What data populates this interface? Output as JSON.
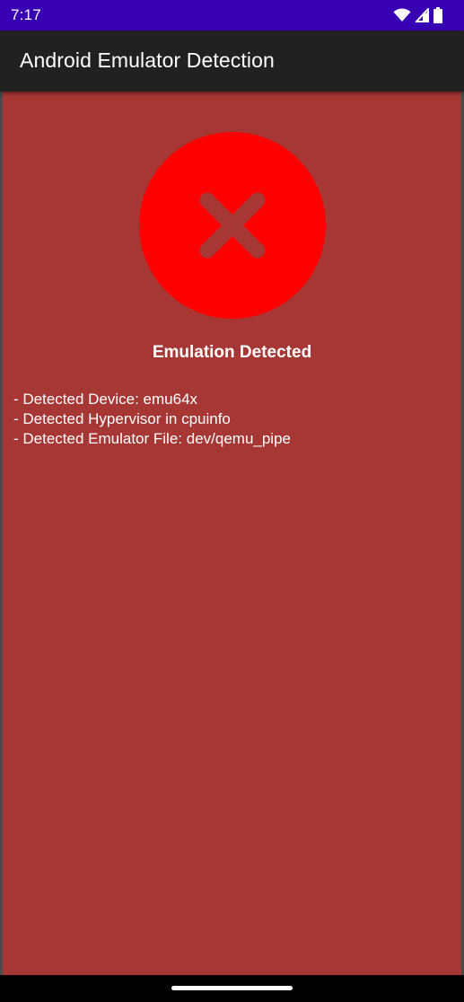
{
  "status_bar": {
    "time": "7:17",
    "icons": [
      "wifi-icon",
      "signal-icon",
      "battery-icon"
    ],
    "color": "#3700b3"
  },
  "app_bar": {
    "title": "Android Emulator Detection",
    "color": "#212121"
  },
  "result": {
    "icon": "cross-icon",
    "circle_color": "#ff0000",
    "background_color": "#a73734",
    "title": "Emulation Detected",
    "details": [
      "- Detected Device: emu64x",
      "- Detected Hypervisor in cpuinfo",
      "- Detected Emulator File: dev/qemu_pipe"
    ]
  }
}
